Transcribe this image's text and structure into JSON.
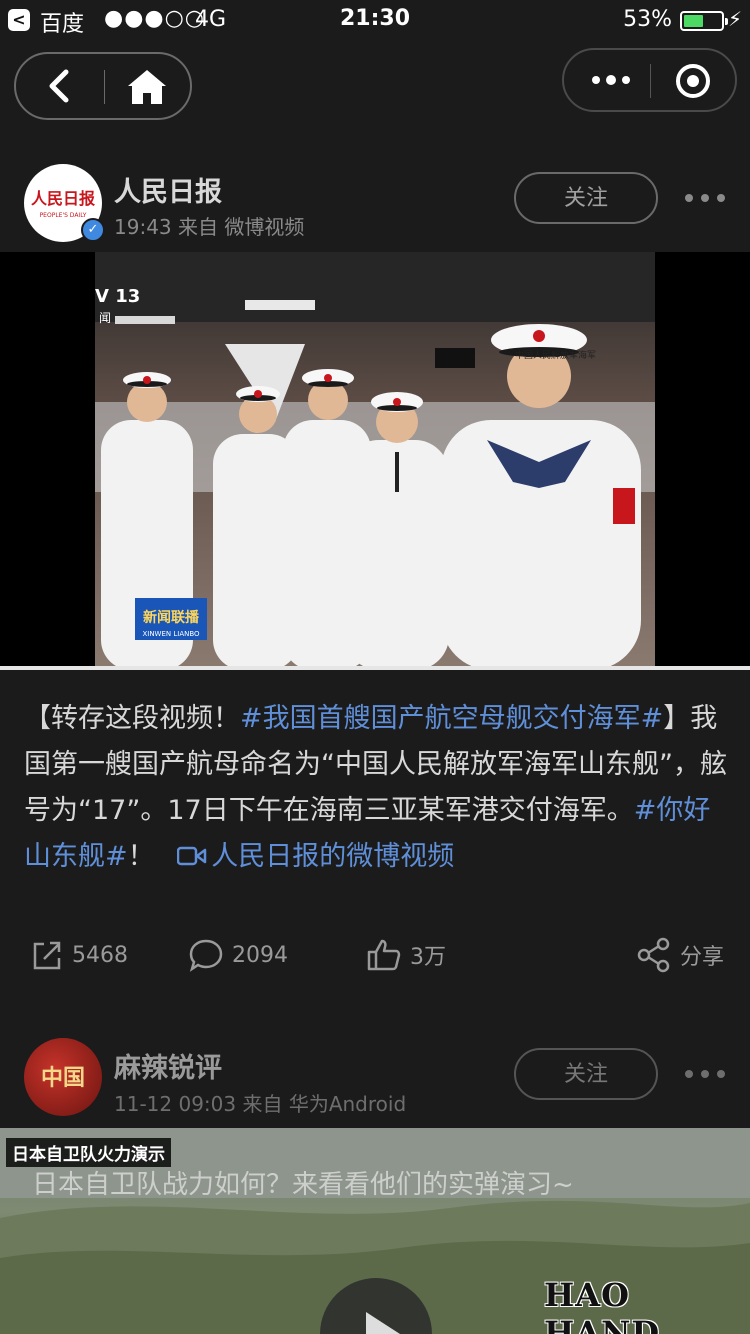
{
  "status_bar": {
    "carrier": "百度",
    "signal": "●●●○○",
    "network": "4G",
    "time": "21:30",
    "battery_percent": "53%",
    "battery_level": 0.53,
    "battery_color": "#4cd964"
  },
  "nav": {
    "back_icon": "back-chevron-icon",
    "home_icon": "home-icon",
    "more_icon": "more-icon",
    "target_icon": "target-icon"
  },
  "post1": {
    "avatar_text": "人民日报",
    "avatar_subtext": "PEOPLE'S DAILY",
    "username": "人民日报",
    "meta": "19:43 来自 微博视频",
    "follow": "关注",
    "video": {
      "channel_badge": "V 13",
      "channel_sub": "闻",
      "logo_text": "新闻联播",
      "logo_sub": "XINWEN LIANBO",
      "cap_text": "中国人民解放军海军"
    },
    "text": {
      "p1": "【转存这段视频！",
      "topic1": "#我国首艘国产航空母舰交付海军#",
      "p2": "】我国第一艘国产航母命名为“中国人民解放军海军山东舰”，舷号为“17”。17日下午在海南三亚某军港交付海军。",
      "topic2": "#你好山东舰#",
      "p3": "！ ",
      "link": "人民日报的微博视频"
    },
    "actions": {
      "repost": "5468",
      "comment": "2094",
      "like": "3万",
      "share": "分享"
    }
  },
  "post2": {
    "avatar_text": "中国",
    "username": "麻辣锐评",
    "meta": "11-12 09:03 来自 华为Android",
    "follow": "关注",
    "video_tag": "日本自卫队火力演示",
    "video_caption": "日本自卫队战力如何？来看看他们的实弹演习~"
  },
  "watermark": "HAO HAND",
  "colors": {
    "background": "#1b1b1b",
    "topic": "#5f8fd8",
    "text": "#d8d8d8",
    "muted": "#8a8a8a"
  }
}
